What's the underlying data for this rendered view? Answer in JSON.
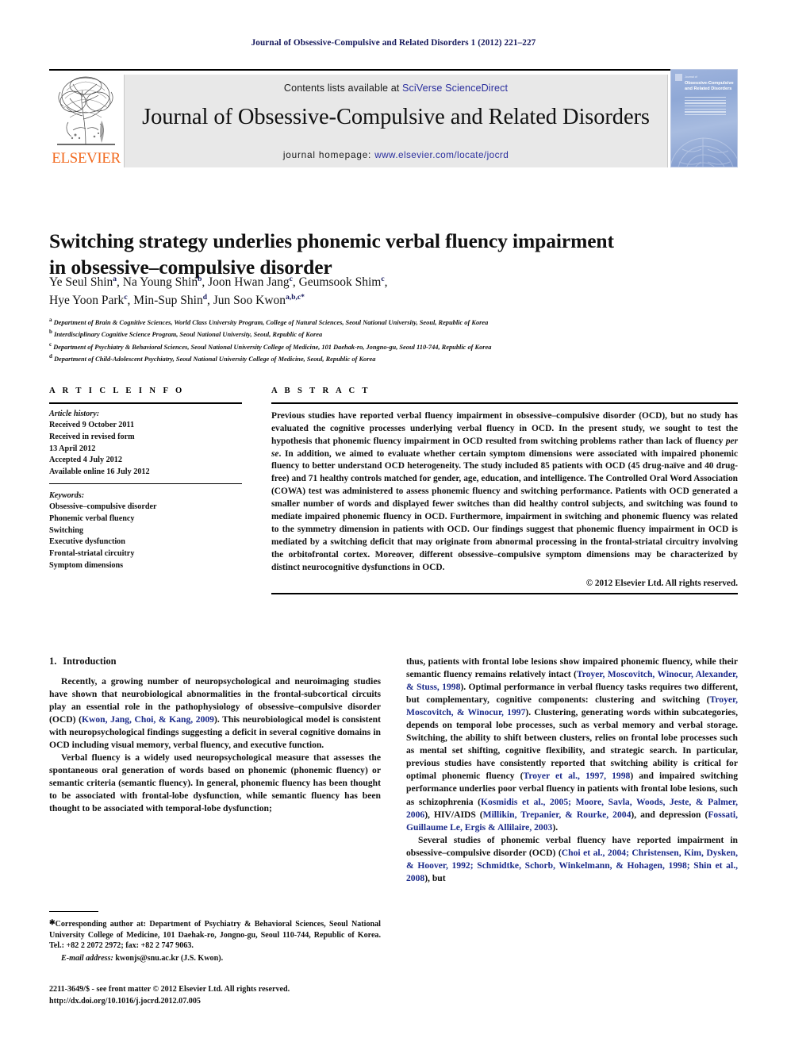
{
  "running_head": "Journal of Obsessive-Compulsive and Related Disorders 1 (2012) 221–227",
  "masthead": {
    "contents_prefix": "Contents lists available at ",
    "contents_link": "SciVerse ScienceDirect",
    "journal_title": "Journal of Obsessive-Compulsive and Related Disorders",
    "homepage_prefix": "journal homepage: ",
    "homepage_url": "www.elsevier.com/locate/jocrd",
    "publisher": "ELSEVIER",
    "cover": {
      "eyebrow": "Journal of",
      "title": "Obsessive-Compulsive and Related Disorders"
    },
    "link_color": "#2b2f9e",
    "band_color": "#e8e8e8",
    "publisher_color": "#F26B21"
  },
  "article": {
    "title_line1": "Switching strategy underlies phonemic verbal fluency impairment",
    "title_line2": "in obsessive–compulsive disorder",
    "authors": [
      {
        "name": "Ye Seul Shin",
        "sup": "a",
        "sep": ", "
      },
      {
        "name": "Na Young Shin",
        "sup": "b",
        "sep": ", "
      },
      {
        "name": "Joon Hwan Jang",
        "sup": "c",
        "sep": ", "
      },
      {
        "name": "Geumsook Shim",
        "sup": "c",
        "sep": ","
      },
      {
        "name": "Hye Yoon Park",
        "sup": "c",
        "sep": ", "
      },
      {
        "name": "Min-Sup Shin",
        "sup": "d",
        "sep": ", "
      },
      {
        "name": "Jun Soo Kwon",
        "sup": "a,b,c",
        "sep": ""
      }
    ],
    "corresponding_marker": "*",
    "affiliations": [
      {
        "mark": "a",
        "text": "Department of Brain & Cognitive Sciences, World Class University Program, College of Natural Sciences, Seoul National University, Seoul, Republic of Korea"
      },
      {
        "mark": "b",
        "text": "Interdisciplinary Cognitive Science Program, Seoul National University, Seoul, Republic of Korea"
      },
      {
        "mark": "c",
        "text": "Department of Psychiatry & Behavioral Sciences, Seoul National University College of Medicine, 101 Daehak-ro, Jongno-gu, Seoul 110-744, Republic of Korea"
      },
      {
        "mark": "d",
        "text": "Department of Child-Adolescent Psychiatry, Seoul National University College of Medicine, Seoul, Republic of Korea"
      }
    ]
  },
  "article_info": {
    "heading": "A R T I C L E   I N F O",
    "history_label": "Article history:",
    "history": [
      "Received 9 October 2011",
      "Received in revised form",
      "13 April 2012",
      "Accepted 4 July 2012",
      "Available online 16 July 2012"
    ],
    "keywords_label": "Keywords:",
    "keywords": [
      "Obsessive–compulsive disorder",
      "Phonemic verbal fluency",
      "Switching",
      "Executive dysfunction",
      "Frontal-striatal circuitry",
      "Symptom dimensions"
    ]
  },
  "abstract": {
    "heading": "A B S T R A C T",
    "text_part1": "Previous studies have reported verbal fluency impairment in obsessive–compulsive disorder (OCD), but no study has evaluated the cognitive processes underlying verbal fluency in OCD. In the present study, we sought to test the hypothesis that phonemic fluency impairment in OCD resulted from switching problems rather than lack of fluency ",
    "text_italic": "per se",
    "text_part2": ". In addition, we aimed to evaluate whether certain symptom dimensions were associated with impaired phonemic fluency to better understand OCD heterogeneity. The study included 85 patients with OCD (45 drug-naïve and 40 drug-free) and 71 healthy controls matched for gender, age, education, and intelligence. The Controlled Oral Word Association (COWA) test was administered to assess phonemic fluency and switching performance. Patients with OCD generated a smaller number of words and displayed fewer switches than did healthy control subjects, and switching was found to mediate impaired phonemic fluency in OCD. Furthermore, impairment in switching and phonemic fluency was related to the symmetry dimension in patients with OCD. Our findings suggest that phonemic fluency impairment in OCD is mediated by a switching deficit that may originate from abnormal processing in the frontal-striatal circuitry involving the orbitofrontal cortex. Moreover, different obsessive–compulsive symptom dimensions may be characterized by distinct neurocognitive dysfunctions in OCD.",
    "copyright": "© 2012 Elsevier Ltd. All rights reserved."
  },
  "intro": {
    "number": "1.",
    "heading": "Introduction",
    "left_p1_a": "Recently, a growing number of neuropsychological and neuroimaging studies have shown that neurobiological abnormalities in the frontal-subcortical circuits play an essential role in the pathophysiology of obsessive–compulsive disorder (OCD) (",
    "left_p1_ref": "Kwon, Jang, Choi, & Kang, 2009",
    "left_p1_b": "). This neurobiological model is consistent with neuropsychological findings suggesting a deficit in several cognitive domains in OCD including visual memory, verbal fluency, and executive function.",
    "left_p2": "Verbal fluency is a widely used neuropsychological measure that assesses the spontaneous oral generation of words based on phonemic (phonemic fluency) or semantic criteria (semantic fluency). In general, phonemic fluency has been thought to be associated with frontal-lobe dysfunction, while semantic fluency has been thought to be associated with temporal-lobe dysfunction;",
    "right_p1_a": "thus, patients with frontal lobe lesions show impaired phonemic fluency, while their semantic fluency remains relatively intact (",
    "right_p1_ref1": "Troyer, Moscovitch, Winocur, Alexander, & Stuss, 1998",
    "right_p1_b": "). Optimal performance in verbal fluency tasks requires two different, but complementary, cognitive components: clustering and switching (",
    "right_p1_ref2": "Troyer, Moscovitch, & Winocur, 1997",
    "right_p1_c": "). Clustering, generating words within subcategories, depends on temporal lobe processes, such as verbal memory and verbal storage. Switching, the ability to shift between clusters, relies on frontal lobe processes such as mental set shifting, cognitive flexibility, and strategic search. In particular, previous studies have consistently reported that switching ability is critical for optimal phonemic fluency (",
    "right_p1_ref3": "Troyer et al., 1997, 1998",
    "right_p1_d": ") and impaired switching performance underlies poor verbal fluency in patients with frontal lobe lesions, such as schizophrenia (",
    "right_p1_ref4": "Kosmidis et al., 2005; Moore, Savla, Woods, Jeste, & Palmer, 2006",
    "right_p1_e": "), HIV/AIDS (",
    "right_p1_ref5": "Millikin, Trepanier, & Rourke, 2004",
    "right_p1_f": "), and depression (",
    "right_p1_ref6": "Fossati, Guillaume Le, Ergis & Allilaire, 2003",
    "right_p1_g": ").",
    "right_p2_a": "Several studies of phonemic verbal fluency have reported impairment in obsessive–compulsive disorder (OCD) (",
    "right_p2_ref": "Choi et al., 2004; Christensen, Kim, Dysken, & Hoover, 1992; Schmidtke, Schorb, Winkelmann, & Hohagen, 1998; Shin et al., 2008",
    "right_p2_b": "), but",
    "ref_color": "#1b2a8a"
  },
  "footnotes": {
    "corresponding": "Corresponding author at: Department of Psychiatry & Behavioral Sciences, Seoul National University College of Medicine, 101 Daehak-ro, Jongno-gu, Seoul 110-744, Republic of Korea. Tel.: +82 2 2072 2972; fax: +82 2 747 9063.",
    "email_label": "E-mail address:",
    "email_value": "kwonjs@snu.ac.kr (J.S. Kwon).",
    "imprint_line1": "2211-3649/$ - see front matter © 2012 Elsevier Ltd. All rights reserved.",
    "imprint_line2": "http://dx.doi.org/10.1016/j.jocrd.2012.07.005"
  }
}
